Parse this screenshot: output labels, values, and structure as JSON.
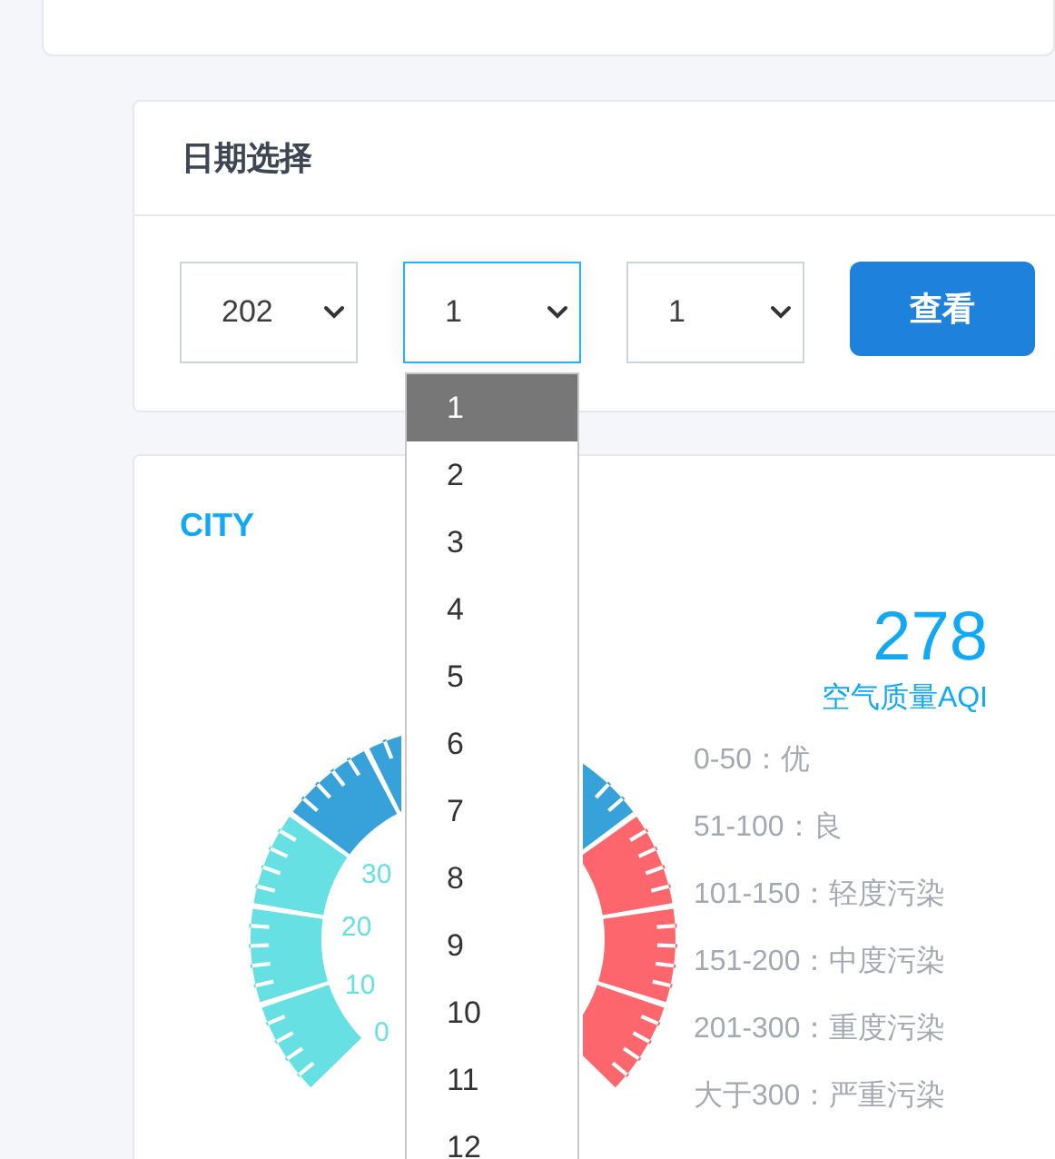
{
  "date_panel": {
    "title": "日期选择",
    "selects": [
      {
        "value": "202",
        "focused": false,
        "open": false
      },
      {
        "value": "1",
        "focused": true,
        "open": true,
        "options": [
          {
            "label": "1",
            "selected": true
          },
          {
            "label": "2",
            "selected": false
          },
          {
            "label": "3",
            "selected": false
          },
          {
            "label": "4",
            "selected": false
          },
          {
            "label": "5",
            "selected": false
          },
          {
            "label": "6",
            "selected": false
          },
          {
            "label": "7",
            "selected": false
          },
          {
            "label": "8",
            "selected": false
          },
          {
            "label": "9",
            "selected": false
          },
          {
            "label": "10",
            "selected": false
          },
          {
            "label": "11",
            "selected": false
          },
          {
            "label": "12",
            "selected": false
          }
        ]
      },
      {
        "value": "1",
        "focused": false,
        "open": false
      }
    ],
    "button": "查看"
  },
  "city_panel": {
    "title": "CITY",
    "aqi_value": "278",
    "aqi_label": "空气质量AQI",
    "gauge_labels": [
      "30",
      "20",
      "10",
      "0"
    ],
    "legend": [
      "0-50：优",
      "51-100：良",
      "101-150：轻度污染",
      "151-200：中度污染",
      "201-300：重度污染",
      "大于300：严重污染"
    ]
  }
}
